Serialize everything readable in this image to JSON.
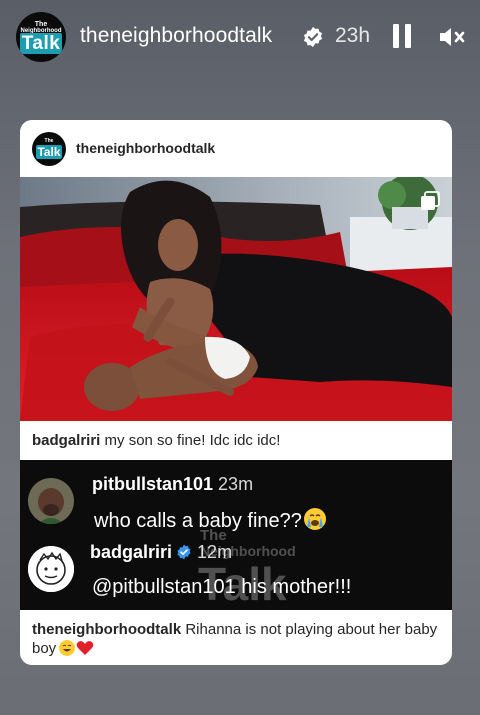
{
  "story": {
    "username": "theneighborhoodtalk",
    "time": "23h",
    "avatar_text_top": "The",
    "avatar_text_mid": "Neighborhood",
    "avatar_text_big": "Talk"
  },
  "post": {
    "username": "theneighborhoodtalk",
    "caption_user": "badgalriri",
    "caption_text": " my son so fine! Idc idc idc!"
  },
  "comments": [
    {
      "user": "pitbullstan101",
      "time": "23m",
      "text": "who calls a baby fine??"
    },
    {
      "user": "badgalriri",
      "time": "12m",
      "text": "@pitbullstan101 his mother!!!"
    }
  ],
  "watermark": {
    "top": "The",
    "mid": "Neighborhood",
    "big": "Talk"
  },
  "footer": {
    "user": "theneighborhoodtalk",
    "text": " Rihanna is not playing about her baby boy"
  },
  "colors": {
    "accent_teal": "#1e9db2",
    "verified_blue": "#3897f0",
    "bed_red": "#c8141c"
  },
  "icons": [
    "verified-icon",
    "pause-icon",
    "mute-icon",
    "multi-post-icon",
    "crying-emoji",
    "laughing-emoji",
    "red-heart-emoji"
  ]
}
